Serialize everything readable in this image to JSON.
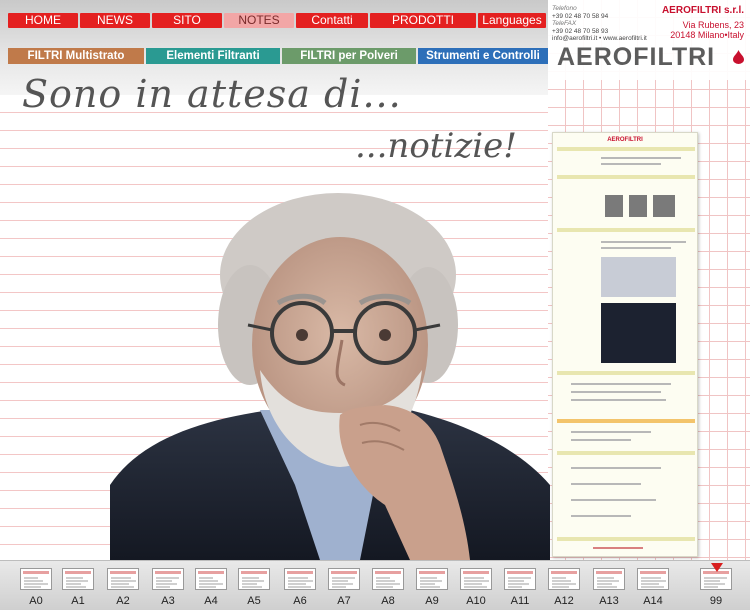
{
  "nav": {
    "items": [
      {
        "label": "HOME",
        "w": 70,
        "active": false
      },
      {
        "label": "NEWS",
        "w": 70,
        "active": false
      },
      {
        "label": "SITO",
        "w": 70,
        "active": false
      },
      {
        "label": "NOTES",
        "w": 70,
        "active": true
      },
      {
        "label": "Contatti",
        "w": 72,
        "active": false
      },
      {
        "label": "PRODOTTI",
        "w": 106,
        "active": false
      },
      {
        "label": "Languages",
        "w": 68,
        "active": false
      }
    ]
  },
  "categories": [
    {
      "label": "FILTRI Multistrato",
      "color": "#c07a4a"
    },
    {
      "label": "Elementi Filtranti",
      "color": "#2a9a92"
    },
    {
      "label": "FILTRI per Polveri",
      "color": "#6c9b6a"
    },
    {
      "label": "Strumenti e Controlli",
      "color": "#2d6fb9"
    }
  ],
  "company": {
    "telefono_label": "Telefono",
    "tel1": "+39 02 48 70 58 94",
    "telefax_label": "TeleFAX",
    "tel2": "+39 02 48 70 58 93",
    "email": "info@aerofiltri.it • www.aerofiltri.it",
    "name": "AEROFILTRI s.r.l.",
    "street": "Via Rubens, 23",
    "city": "20148 Milano•Italy",
    "logo": "AEROFILTRI"
  },
  "headline": {
    "line1": "Sono in attesa di...",
    "line2": "...notizie!"
  },
  "newsletter": {
    "header": "AEROFILTRI"
  },
  "thumbs": [
    {
      "label": "A0"
    },
    {
      "label": "A1"
    },
    {
      "label": "A2"
    },
    {
      "label": "A3"
    },
    {
      "label": "A4"
    },
    {
      "label": "A5"
    },
    {
      "label": "A6"
    },
    {
      "label": "A7"
    },
    {
      "label": "A8"
    },
    {
      "label": "A9"
    },
    {
      "label": "A10"
    },
    {
      "label": "A11"
    },
    {
      "label": "A12"
    },
    {
      "label": "A13"
    },
    {
      "label": "A14"
    },
    {
      "label": "99"
    }
  ],
  "colors": {
    "nav_red": "#e42020",
    "brand_red": "#c8102e"
  }
}
